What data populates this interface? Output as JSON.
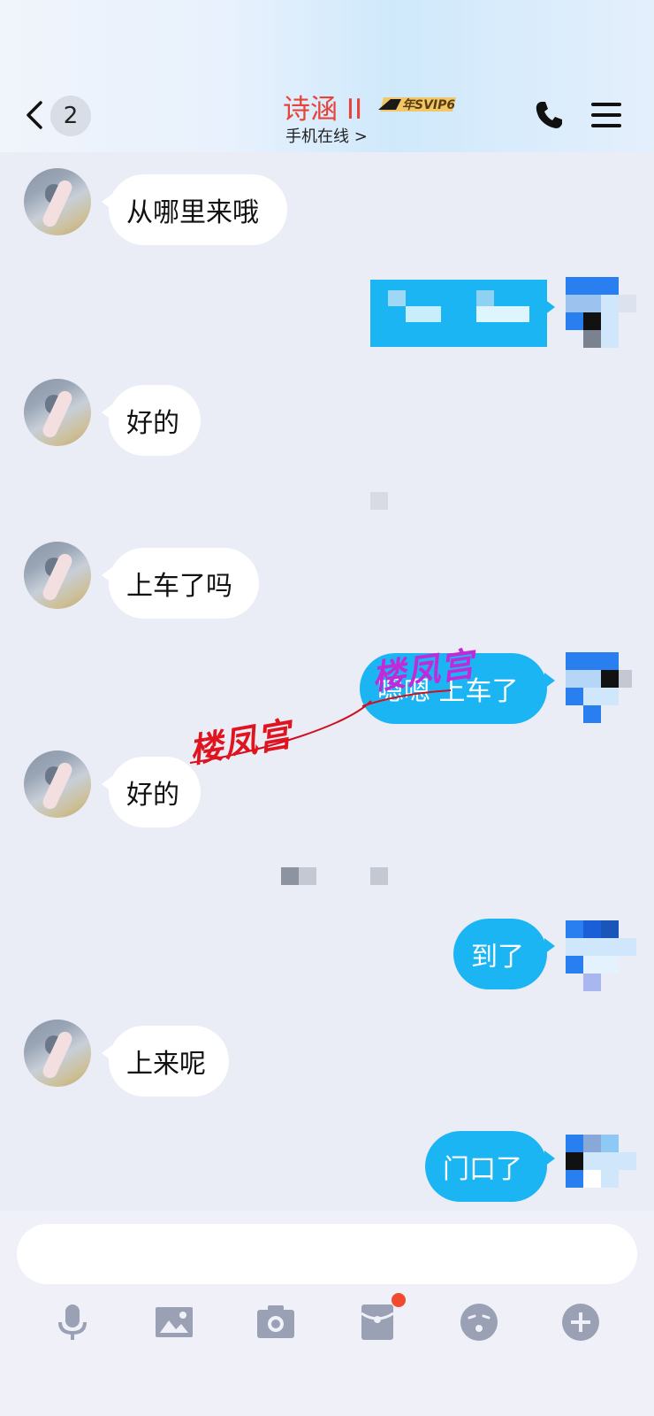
{
  "header": {
    "back_count": "2",
    "contact_name": "诗涵 II",
    "vip_badge": "年SVIP6",
    "status": "手机在线 >"
  },
  "messages": [
    {
      "side": "in",
      "text": "从哪里来哦"
    },
    {
      "side": "out",
      "text": ""
    },
    {
      "side": "in",
      "text": "好的"
    },
    {
      "side": "in",
      "text": "上车了吗"
    },
    {
      "side": "out",
      "text": "嗯嗯 上车了"
    },
    {
      "side": "in",
      "text": "好的"
    },
    {
      "side": "out",
      "text": "到了"
    },
    {
      "side": "in",
      "text": "上来呢"
    },
    {
      "side": "out",
      "text": "门口了"
    }
  ],
  "watermark": {
    "text_left": "楼凤宫",
    "text_right": "楼凤宫"
  },
  "toolbar": {
    "icons": [
      "microphone-icon",
      "image-icon",
      "camera-icon",
      "red-packet-icon",
      "emoji-icon",
      "plus-icon"
    ]
  },
  "colors": {
    "accent": "#1cb5f4",
    "name": "#e8433a",
    "background": "#ebedf6",
    "notify": "#f24a2e"
  }
}
